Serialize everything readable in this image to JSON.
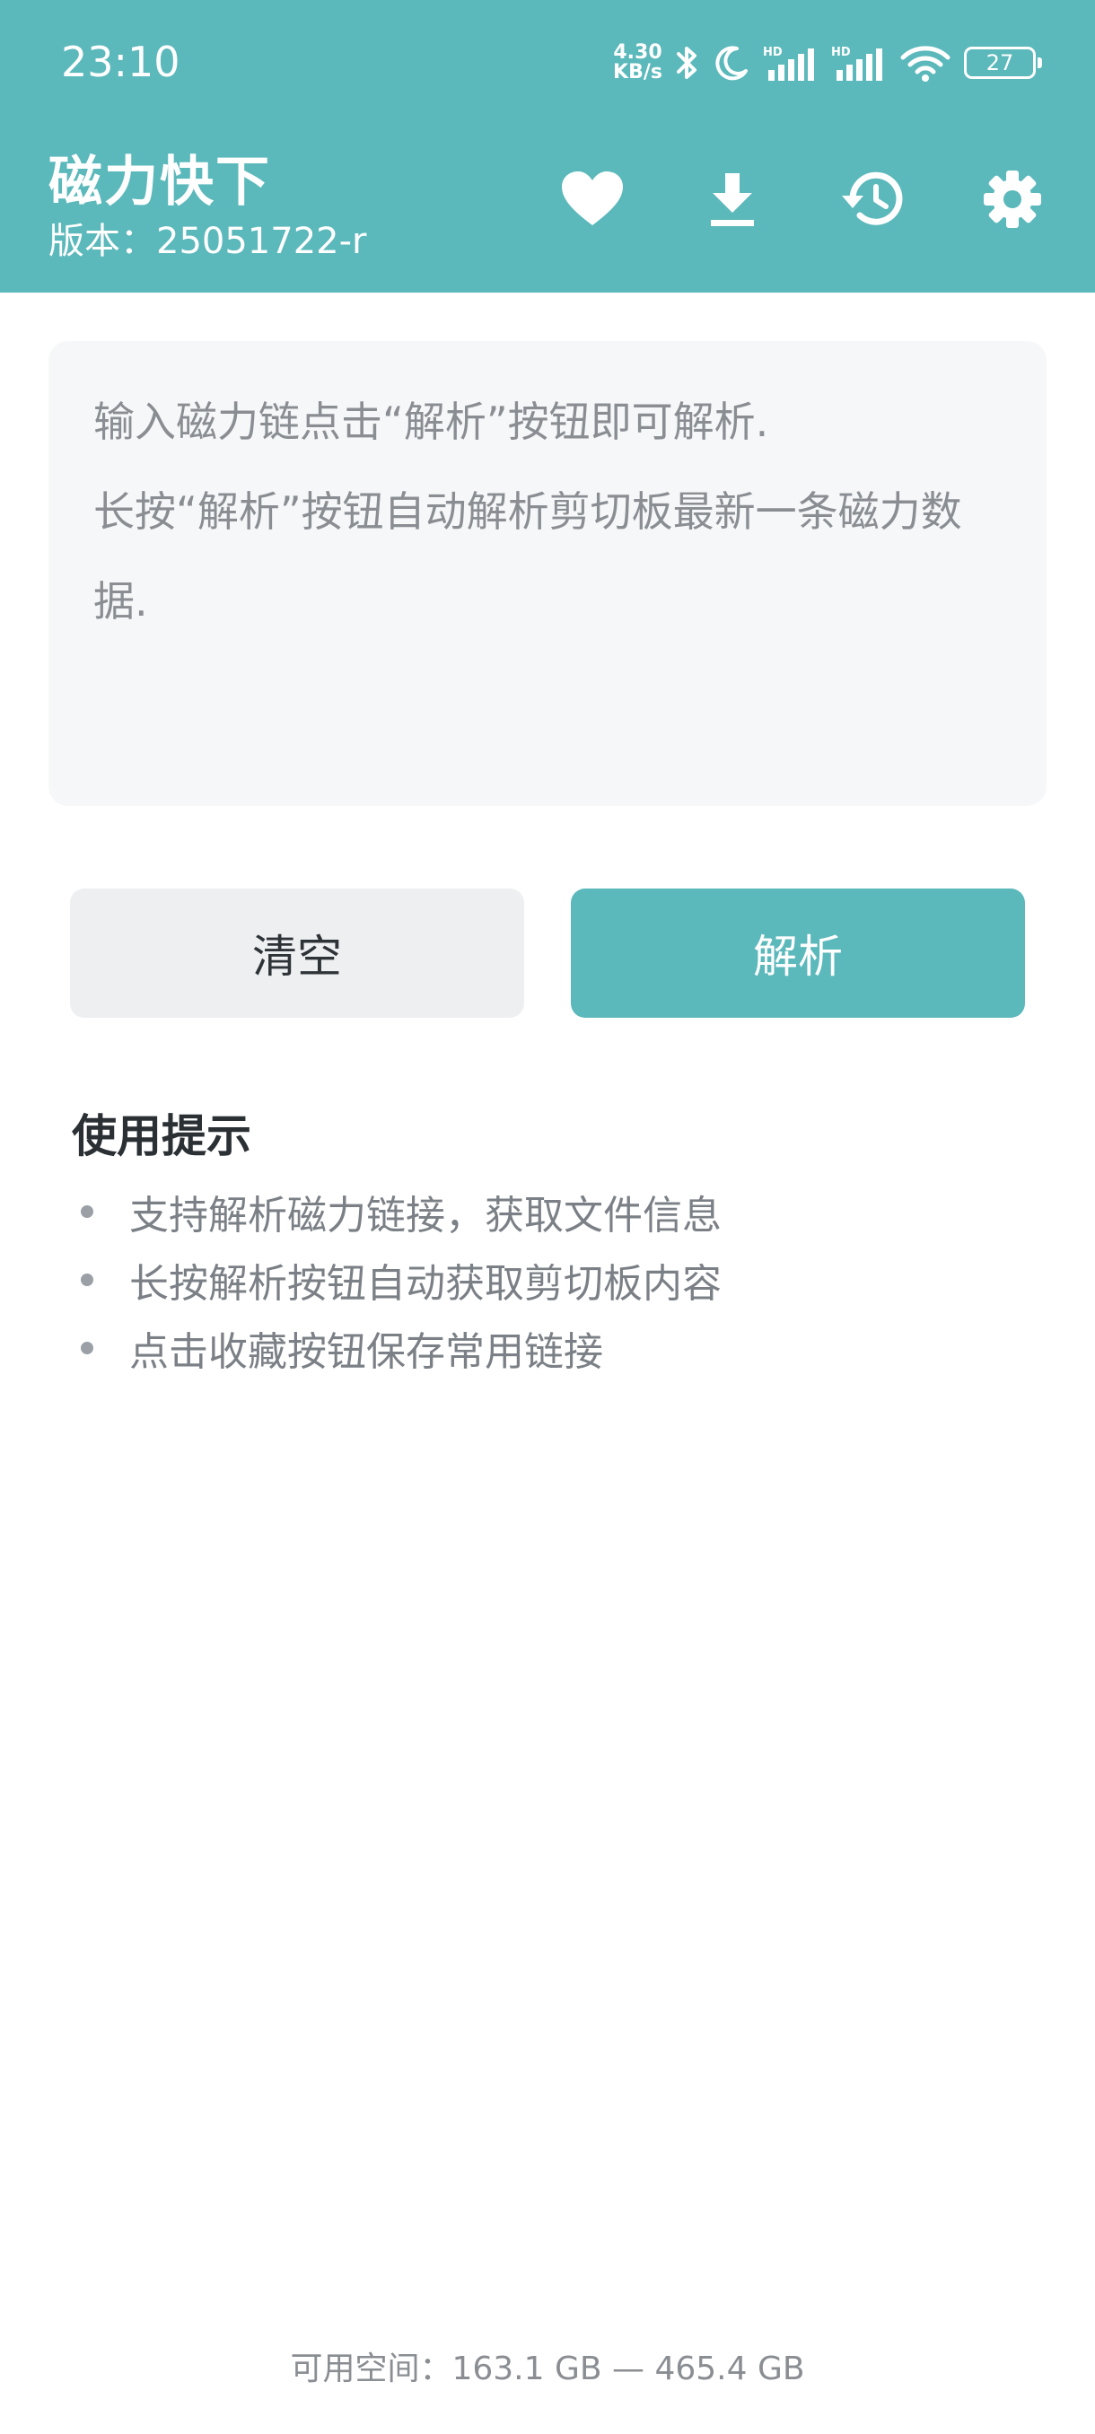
{
  "status_bar": {
    "time": "23:10",
    "net_speed_value": "4.30",
    "net_speed_unit": "KB/s",
    "battery": "27",
    "icons": [
      "bluetooth-icon",
      "moon-icon",
      "signal-hd-icon",
      "signal-hd-icon",
      "wifi-icon",
      "battery-icon"
    ]
  },
  "header": {
    "title": "磁力快下",
    "version": "版本：25051722-r",
    "actions": [
      "heart-icon",
      "download-icon",
      "history-icon",
      "gear-icon"
    ]
  },
  "input": {
    "placeholder_line1": "输入磁力链点击“解析”按钮即可解析.",
    "placeholder_line2": "长按“解析”按钮自动解析剪切板最新一条磁力数据."
  },
  "buttons": {
    "clear_label": "清空",
    "parse_label": "解析"
  },
  "tips": {
    "title": "使用提示",
    "items": [
      "支持解析磁力链接，获取文件信息",
      "长按解析按钮自动获取剪切板内容",
      "点击收藏按钮保存常用链接"
    ]
  },
  "footer": {
    "storage_text": "可用空间：163.1 GB — 465.4 GB"
  },
  "colors": {
    "accent": "#5bb8bb",
    "input_bg": "#f6f7f8",
    "clear_button_bg": "#eeeff1",
    "hint_text": "#8a8e93"
  }
}
